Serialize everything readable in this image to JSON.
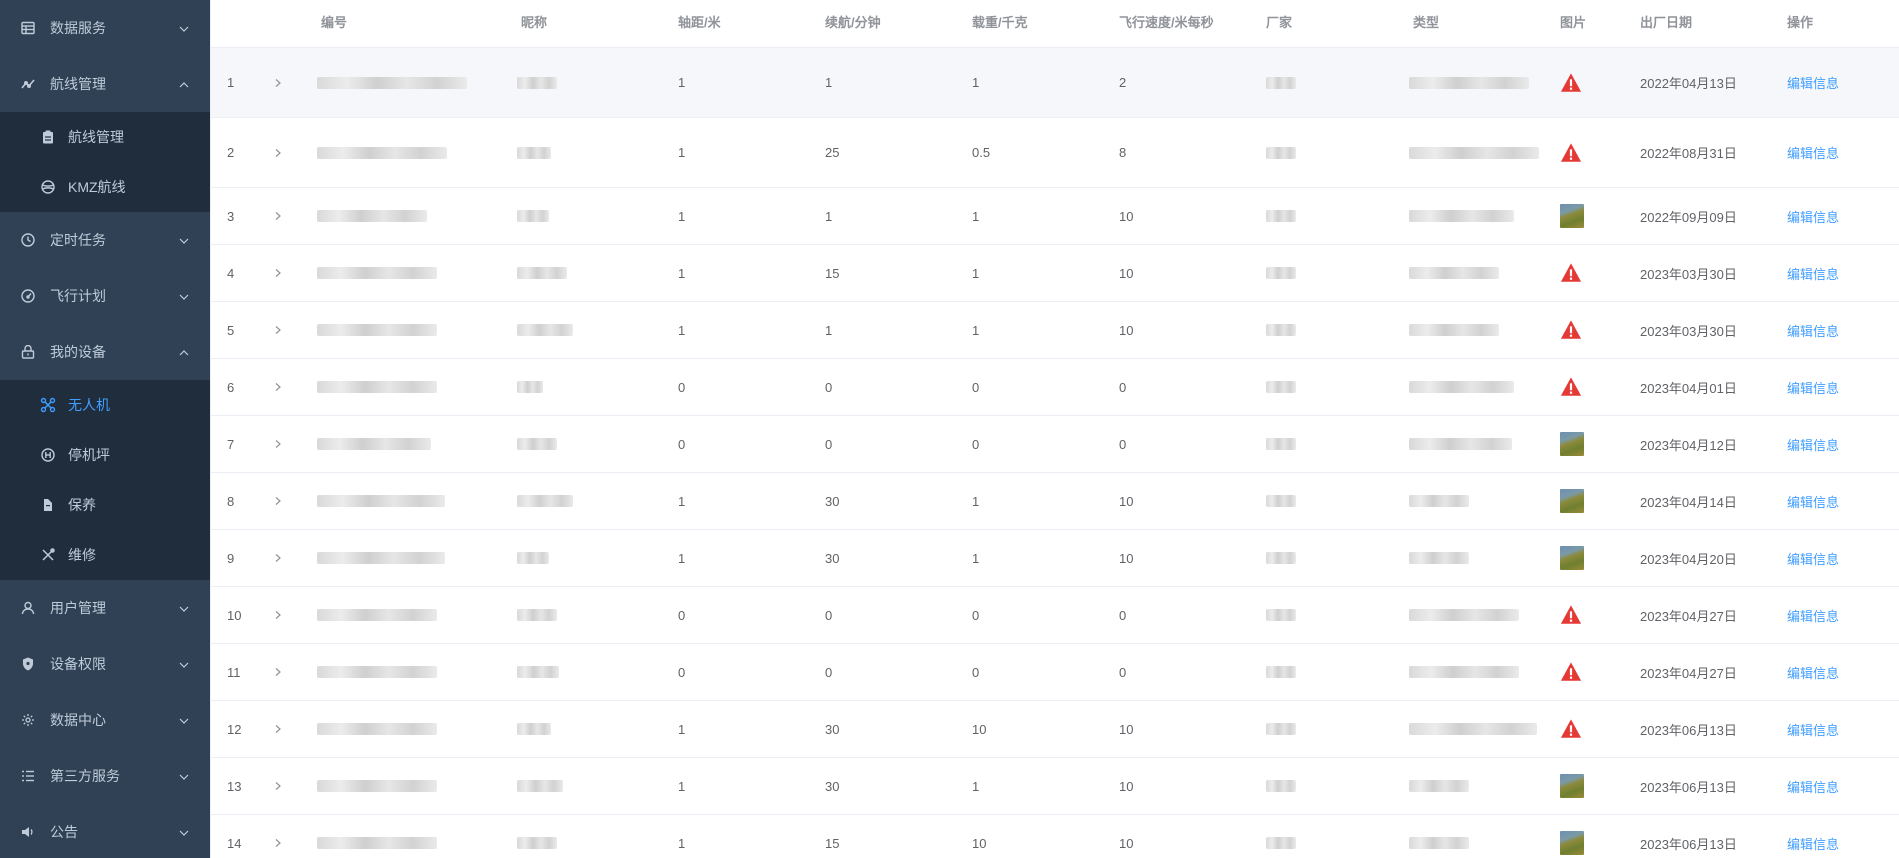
{
  "sidebar": {
    "items": [
      {
        "label": "数据服务",
        "icon": "table-icon",
        "expanded": false
      },
      {
        "label": "航线管理",
        "icon": "route-icon",
        "expanded": true,
        "children": [
          {
            "label": "航线管理",
            "icon": "clipboard-icon"
          },
          {
            "label": "KMZ航线",
            "icon": "globe-icon"
          }
        ]
      },
      {
        "label": "定时任务",
        "icon": "clock-icon",
        "expanded": false
      },
      {
        "label": "飞行计划",
        "icon": "gauge-icon",
        "expanded": false
      },
      {
        "label": "我的设备",
        "icon": "device-icon",
        "expanded": true,
        "children": [
          {
            "label": "无人机",
            "icon": "drone-icon",
            "active": true
          },
          {
            "label": "停机坪",
            "icon": "helipad-icon"
          },
          {
            "label": "保养",
            "icon": "maintenance-icon"
          },
          {
            "label": "维修",
            "icon": "tools-icon"
          }
        ]
      },
      {
        "label": "用户管理",
        "icon": "user-icon",
        "expanded": false
      },
      {
        "label": "设备权限",
        "icon": "shield-icon",
        "expanded": false
      },
      {
        "label": "数据中心",
        "icon": "gear-icon",
        "expanded": false
      },
      {
        "label": "第三方服务",
        "icon": "list-icon",
        "expanded": false
      },
      {
        "label": "公告",
        "icon": "speaker-icon",
        "expanded": false
      }
    ]
  },
  "table": {
    "columns": [
      "编号",
      "昵称",
      "轴距/米",
      "续航/分钟",
      "载重/千克",
      "飞行速度/米每秒",
      "厂家",
      "类型",
      "图片",
      "出厂日期",
      "操作"
    ],
    "action_label": "编辑信息",
    "rows": [
      {
        "index": "1",
        "wheelbase": "1",
        "endurance": "1",
        "payload": "1",
        "speed": "2",
        "image": "broken",
        "date": "2022年04月13日"
      },
      {
        "index": "2",
        "wheelbase": "1",
        "endurance": "25",
        "payload": "0.5",
        "speed": "8",
        "image": "broken",
        "date": "2022年08月31日"
      },
      {
        "index": "3",
        "wheelbase": "1",
        "endurance": "1",
        "payload": "1",
        "speed": "10",
        "image": "photo",
        "date": "2022年09月09日"
      },
      {
        "index": "4",
        "wheelbase": "1",
        "endurance": "15",
        "payload": "1",
        "speed": "10",
        "image": "broken",
        "date": "2023年03月30日"
      },
      {
        "index": "5",
        "wheelbase": "1",
        "endurance": "1",
        "payload": "1",
        "speed": "10",
        "image": "broken",
        "date": "2023年03月30日"
      },
      {
        "index": "6",
        "wheelbase": "0",
        "endurance": "0",
        "payload": "0",
        "speed": "0",
        "image": "broken",
        "date": "2023年04月01日"
      },
      {
        "index": "7",
        "wheelbase": "0",
        "endurance": "0",
        "payload": "0",
        "speed": "0",
        "image": "photo",
        "date": "2023年04月12日"
      },
      {
        "index": "8",
        "wheelbase": "1",
        "endurance": "30",
        "payload": "1",
        "speed": "10",
        "image": "photo",
        "date": "2023年04月14日"
      },
      {
        "index": "9",
        "wheelbase": "1",
        "endurance": "30",
        "payload": "1",
        "speed": "10",
        "image": "photo",
        "date": "2023年04月20日"
      },
      {
        "index": "10",
        "wheelbase": "0",
        "endurance": "0",
        "payload": "0",
        "speed": "0",
        "image": "broken",
        "date": "2023年04月27日"
      },
      {
        "index": "11",
        "wheelbase": "0",
        "endurance": "0",
        "payload": "0",
        "speed": "0",
        "image": "broken",
        "date": "2023年04月27日"
      },
      {
        "index": "12",
        "wheelbase": "1",
        "endurance": "30",
        "payload": "10",
        "speed": "10",
        "image": "broken",
        "date": "2023年06月13日"
      },
      {
        "index": "13",
        "wheelbase": "1",
        "endurance": "30",
        "payload": "1",
        "speed": "10",
        "image": "photo",
        "date": "2023年06月13日"
      },
      {
        "index": "14",
        "wheelbase": "1",
        "endurance": "15",
        "payload": "10",
        "speed": "10",
        "image": "photo",
        "date": "2023年06月13日"
      }
    ]
  },
  "colors": {
    "sidebar_bg": "#304156",
    "submenu_bg": "#1f2d3d",
    "accent": "#409eff",
    "warning": "#e53935"
  }
}
